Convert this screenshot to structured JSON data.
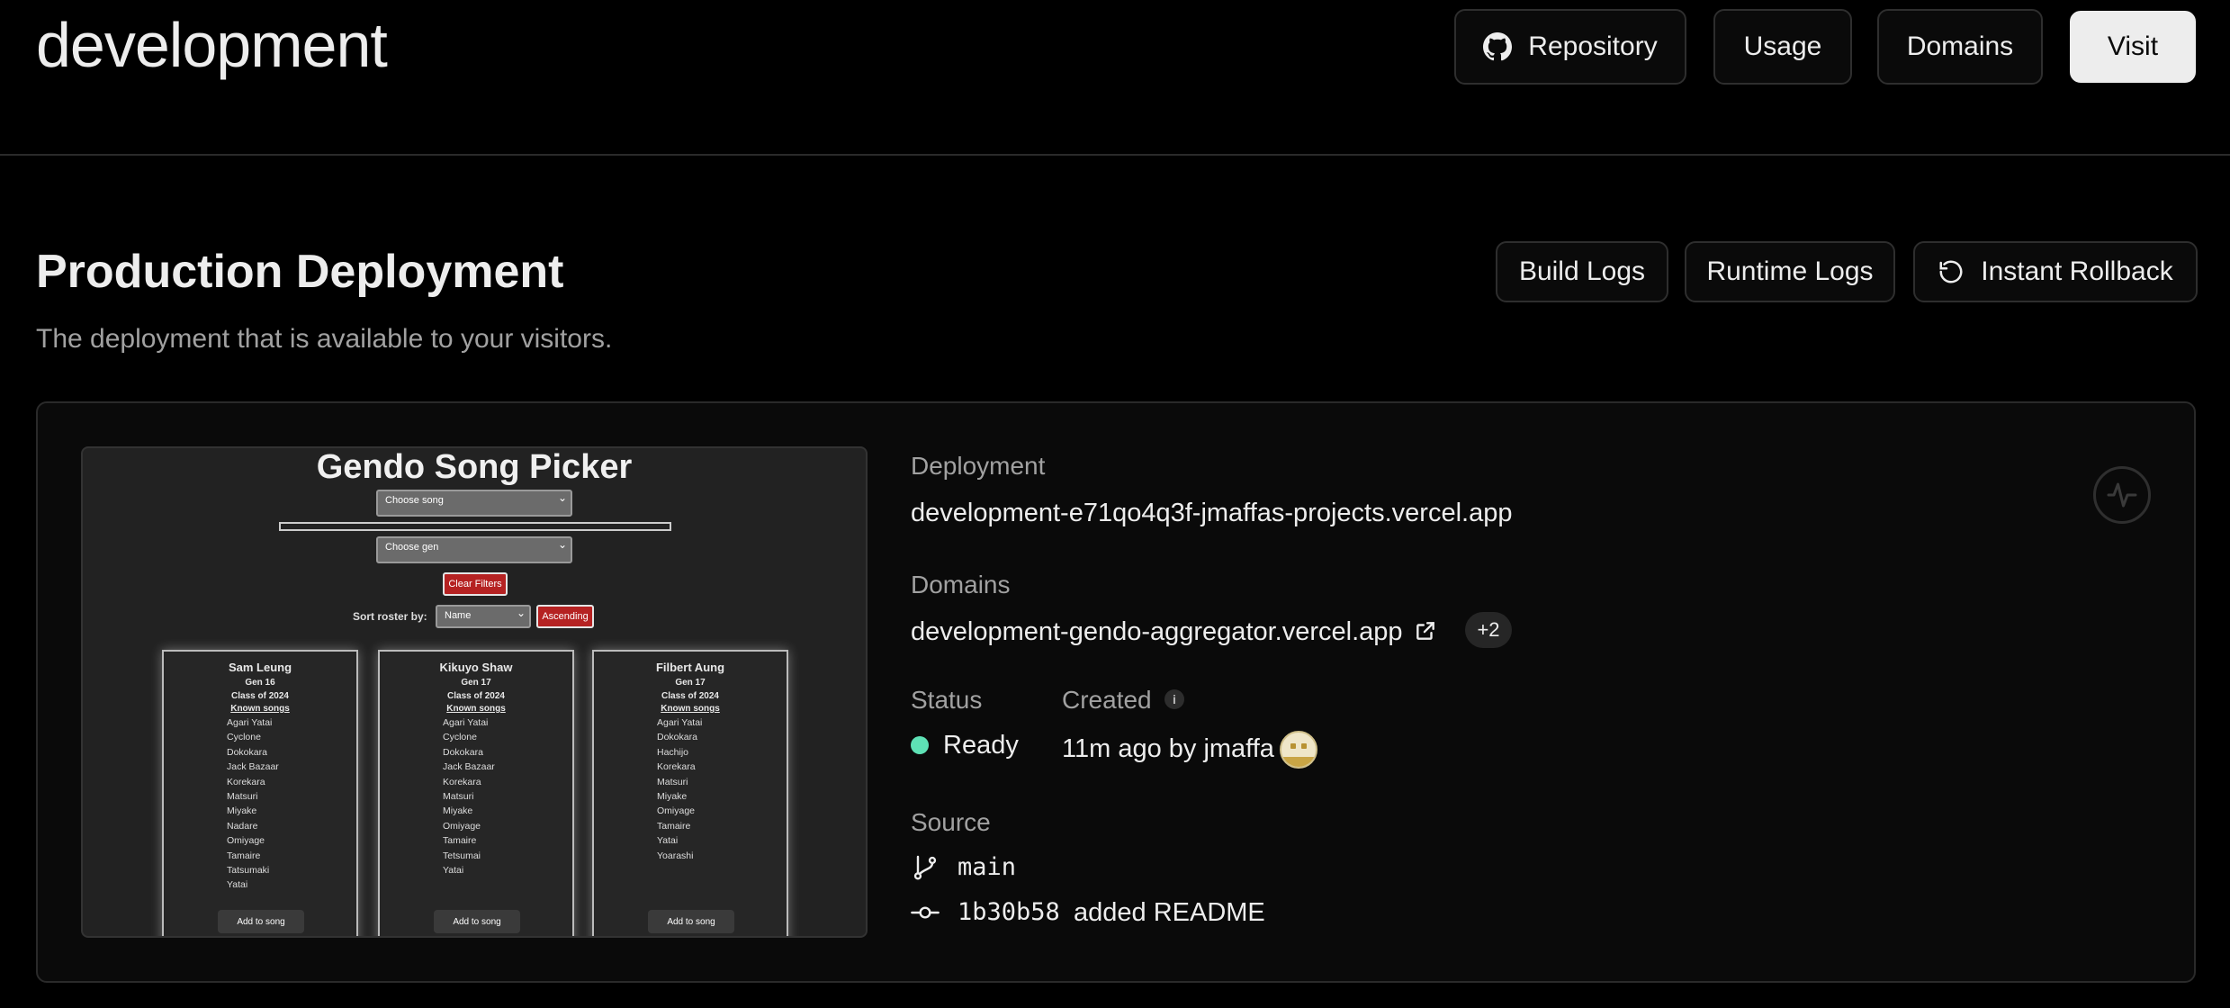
{
  "header": {
    "title": "development",
    "buttons": {
      "repository": "Repository",
      "usage": "Usage",
      "domains": "Domains",
      "visit": "Visit"
    }
  },
  "production": {
    "title": "Production Deployment",
    "subtitle": "The deployment that is available to your visitors.",
    "buttons": {
      "build_logs": "Build Logs",
      "runtime_logs": "Runtime Logs",
      "rollback": "Instant Rollback"
    }
  },
  "preview": {
    "title": "Gendo Song Picker",
    "song_select": "Choose song",
    "gen_select": "Choose gen",
    "clear_filters": "Clear Filters",
    "sort_label": "Sort roster by:",
    "sort_value": "Name",
    "order_button": "Ascending",
    "members": [
      {
        "name": "Sam Leung",
        "gen": "Gen 16",
        "class": "Class of 2024",
        "known": "Known songs",
        "songs": [
          "Agari Yatai",
          "Cyclone",
          "Dokokara",
          "Jack Bazaar",
          "Korekara",
          "Matsuri",
          "Miyake",
          "Nadare",
          "Omiyage",
          "Tamaire",
          "Tatsumaki",
          "Yatai"
        ],
        "add": "Add to song"
      },
      {
        "name": "Kikuyo Shaw",
        "gen": "Gen 17",
        "class": "Class of 2024",
        "known": "Known songs",
        "songs": [
          "Agari Yatai",
          "Cyclone",
          "Dokokara",
          "Jack Bazaar",
          "Korekara",
          "Matsuri",
          "Miyake",
          "Omiyage",
          "Tamaire",
          "Tetsumai",
          "Yatai"
        ],
        "add": "Add to song"
      },
      {
        "name": "Filbert Aung",
        "gen": "Gen 17",
        "class": "Class of 2024",
        "known": "Known songs",
        "songs": [
          "Agari Yatai",
          "Dokokara",
          "Hachijo",
          "Korekara",
          "Matsuri",
          "Miyake",
          "Omiyage",
          "Tamaire",
          "Yatai",
          "Yoarashi"
        ],
        "add": "Add to song"
      }
    ]
  },
  "details": {
    "deployment_label": "Deployment",
    "deployment_url": "development-e71qo4q3f-jmaffas-projects.vercel.app",
    "domains_label": "Domains",
    "domain_url": "development-gendo-aggregator.vercel.app",
    "domains_extra": "+2",
    "status_label": "Status",
    "status_value": "Ready",
    "status_color": "#5ee1b5",
    "created_label": "Created",
    "created_value": "11m ago by jmaffa",
    "source_label": "Source",
    "branch": "main",
    "commit_hash": "1b30b58",
    "commit_message": "added README"
  }
}
